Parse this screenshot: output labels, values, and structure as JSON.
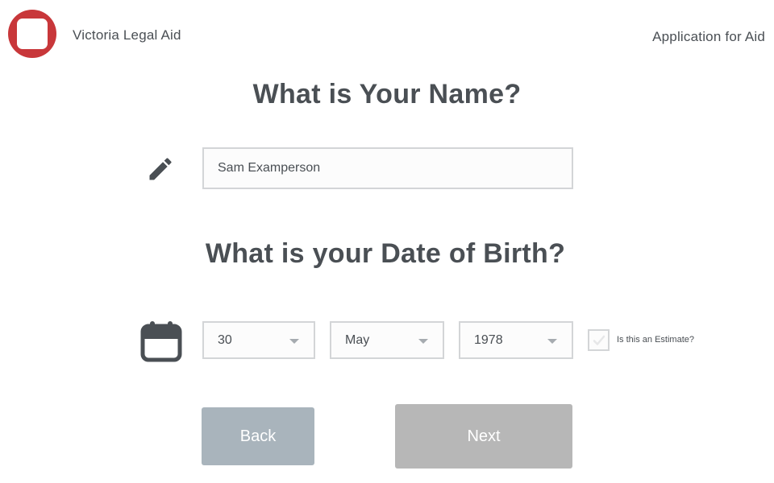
{
  "header": {
    "org_name": "Victoria Legal Aid",
    "app_title": "Application for Aid",
    "logo_color": "#c8373a"
  },
  "name_section": {
    "heading": "What is Your Name?",
    "icon": "pencil-icon",
    "name_value": "Sam Examperson"
  },
  "dob_section": {
    "heading": "What is your Date of Birth?",
    "icon": "calendar-icon",
    "day": "30",
    "month": "May",
    "year": "1978",
    "estimate_label": "Is this an Estimate?",
    "estimate_checked": false
  },
  "actions": {
    "back_label": "Back",
    "next_label": "Next",
    "back_color": "#a9b4bc",
    "next_color": "#b7b7b7"
  }
}
